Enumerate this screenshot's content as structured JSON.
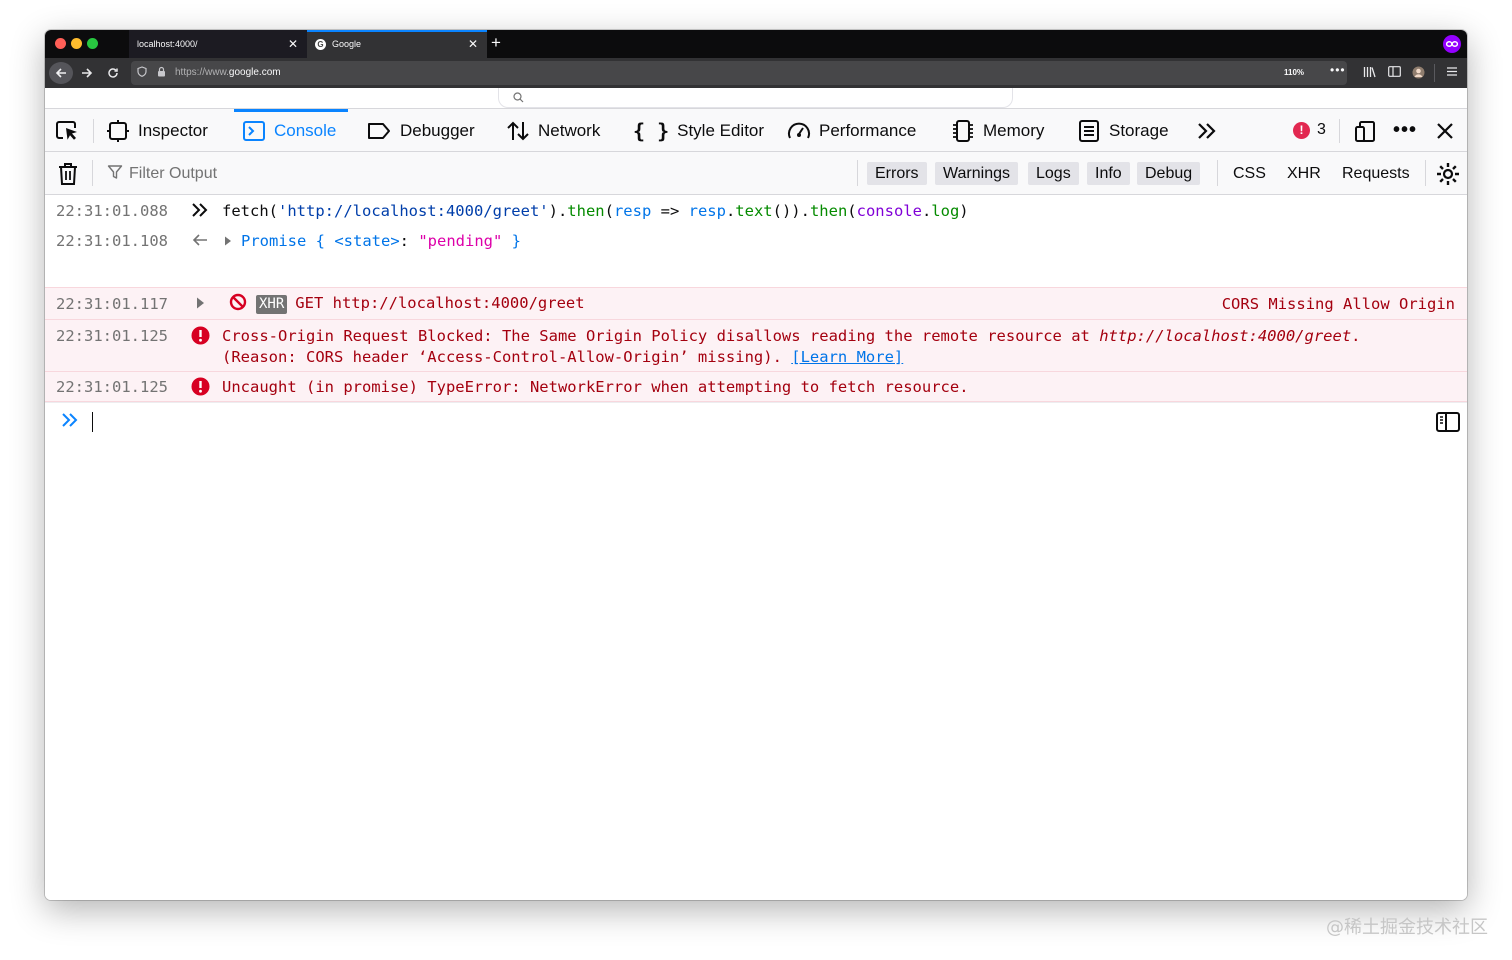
{
  "browser": {
    "tabs": [
      {
        "title": "localhost:4000/",
        "close": "✕"
      },
      {
        "title": "Google",
        "close": "✕",
        "favicon": "G"
      }
    ],
    "new_tab": "+",
    "url_prefix": "https://www.",
    "url_host": "google.com",
    "zoom": "110%",
    "page_actions": "•••"
  },
  "devtools": {
    "tabs": {
      "inspector": "Inspector",
      "console": "Console",
      "debugger": "Debugger",
      "network": "Network",
      "style_editor": "Style Editor",
      "performance": "Performance",
      "memory": "Memory",
      "storage": "Storage"
    },
    "selected_tab": "Console",
    "error_count": "3",
    "more_tools": "•••",
    "accent": "#0a84ff"
  },
  "filter": {
    "placeholder": "Filter Output",
    "levels": [
      "Errors",
      "Warnings",
      "Logs",
      "Info",
      "Debug"
    ],
    "types": [
      "CSS",
      "XHR",
      "Requests"
    ]
  },
  "console": {
    "rows": [
      {
        "time": "22:31:01.088",
        "kind": "input",
        "tokens": {
          "a": "fetch(",
          "b": "'http://localhost:4000/greet'",
          "c": ").",
          "d": "then",
          "e": "(",
          "f": "resp",
          "g": " => ",
          "h": "resp",
          "i": ".",
          "j": "text",
          "k": "()).",
          "l": "then",
          "m": "(",
          "n": "console",
          "o": ".",
          "p": "log",
          "q": ")"
        }
      },
      {
        "time": "22:31:01.108",
        "kind": "result",
        "tokens": {
          "a": "Promise { ",
          "b": "<state>",
          "c": ": ",
          "d": "\"pending\"",
          "e": " }"
        }
      },
      {
        "time": "22:31:01.117",
        "kind": "network-error",
        "badge": "XHR",
        "text": "GET http://localhost:4000/greet",
        "right_text": "CORS Missing Allow Origin"
      },
      {
        "time": "22:31:01.125",
        "kind": "error",
        "line1_a": "Cross-Origin Request Blocked: The Same Origin Policy disallows reading the remote resource at ",
        "line1_b": "http://localhost:4000/greet",
        "line1_c": ".",
        "line2_a": "(Reason: CORS header ‘Access-Control-Allow-Origin’ missing). ",
        "line2_link": "[Learn More]"
      },
      {
        "time": "22:31:01.125",
        "kind": "error",
        "text": "Uncaught (in promise) TypeError: NetworkError when attempting to fetch resource."
      }
    ],
    "error_color": "#a4000f",
    "error_bg": "#fdf2f5"
  },
  "watermark": "@稀土掘金技术社区"
}
